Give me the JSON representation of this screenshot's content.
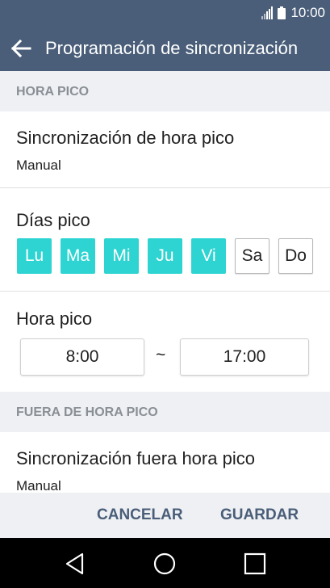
{
  "status_bar": {
    "time": "10:00",
    "icons": [
      "signal-icon",
      "battery-icon"
    ]
  },
  "app_bar": {
    "back_icon": "arrow-left-icon",
    "title": "Programación de sincronización"
  },
  "sections": {
    "peak": {
      "header": "HORA PICO",
      "sync": {
        "title": "Sincronización de hora pico",
        "value": "Manual"
      },
      "days": {
        "title": "Días pico",
        "items": [
          {
            "label": "Lu",
            "selected": true
          },
          {
            "label": "Ma",
            "selected": true
          },
          {
            "label": "Mi",
            "selected": true
          },
          {
            "label": "Ju",
            "selected": true
          },
          {
            "label": "Vi",
            "selected": true
          },
          {
            "label": "Sa",
            "selected": false
          },
          {
            "label": "Do",
            "selected": false
          }
        ]
      },
      "time": {
        "title": "Hora pico",
        "start": "8:00",
        "separator": "~",
        "end": "17:00"
      }
    },
    "off_peak": {
      "header": "FUERA DE HORA PICO",
      "sync": {
        "title": "Sincronización fuera hora pico",
        "value": "Manual"
      }
    }
  },
  "actions": {
    "cancel": "CANCELAR",
    "save": "GUARDAR"
  },
  "nav_bar": {
    "icons": [
      "back-triangle-icon",
      "home-circle-icon",
      "recents-square-icon"
    ]
  },
  "colors": {
    "primary": "#4a5e79",
    "accent": "#2ed4d1",
    "section_bg": "#eef0f3",
    "section_text": "#8a8f96"
  }
}
